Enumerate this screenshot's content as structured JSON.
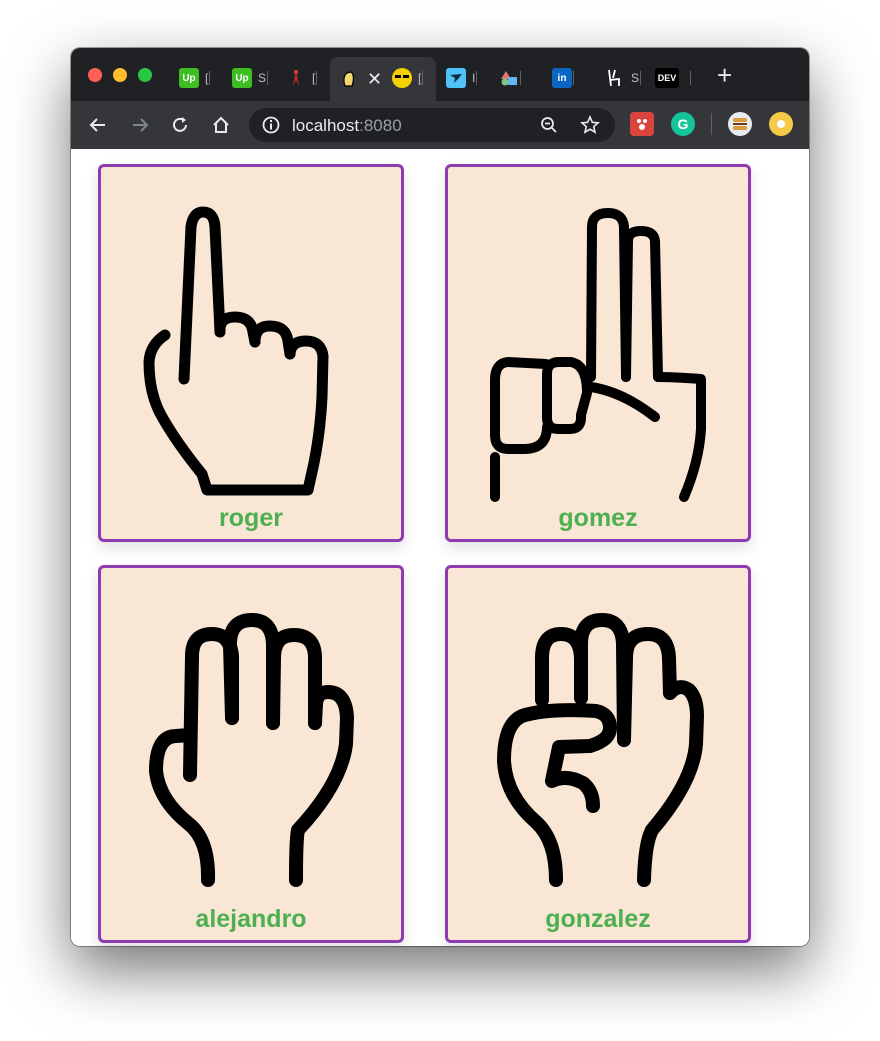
{
  "browser": {
    "address": {
      "host": "localhost",
      "port": ":8080"
    },
    "tabs": [
      {
        "icon": "upwork-icon",
        "label": "Up",
        "title": "[",
        "color": "#3fbe23"
      },
      {
        "icon": "upwork-icon",
        "label": "Up",
        "title": "S",
        "color": "#3fbe23"
      },
      {
        "icon": "vue-logo-icon",
        "label": "",
        "title": "[",
        "color": "#c62828"
      },
      {
        "icon": "hand-favicon-icon",
        "label": "",
        "title": "",
        "color": "#f5d76e",
        "active": true
      },
      {
        "icon": "emoji-face-icon",
        "label": "",
        "title": "[",
        "color": "#f5d000"
      },
      {
        "icon": "bird-icon",
        "label": "",
        "title": "I",
        "color": "#4fc3f7"
      },
      {
        "icon": "shapes-icon",
        "label": "",
        "title": "",
        "color": "#90a4ae"
      },
      {
        "icon": "linkedin-icon",
        "label": "in",
        "title": "",
        "color": "#0a66c2"
      },
      {
        "icon": "peace-hand-icon",
        "label": "",
        "title": "S",
        "color": "#ffffff"
      },
      {
        "icon": "dev-icon",
        "label": "DEV",
        "title": "",
        "color": "#000000"
      }
    ]
  },
  "cards": [
    {
      "name": "roger",
      "icon": "index-finger-hand-icon"
    },
    {
      "name": "gomez",
      "icon": "two-fingers-hand-icon"
    },
    {
      "name": "alejandro",
      "icon": "three-fingers-hand-icon"
    },
    {
      "name": "gonzalez",
      "icon": "fist-thumb-hand-icon"
    }
  ],
  "colors": {
    "card_bg": "#f9e6d4",
    "card_border": "#8e3ab0",
    "name_text": "#4caf50"
  }
}
